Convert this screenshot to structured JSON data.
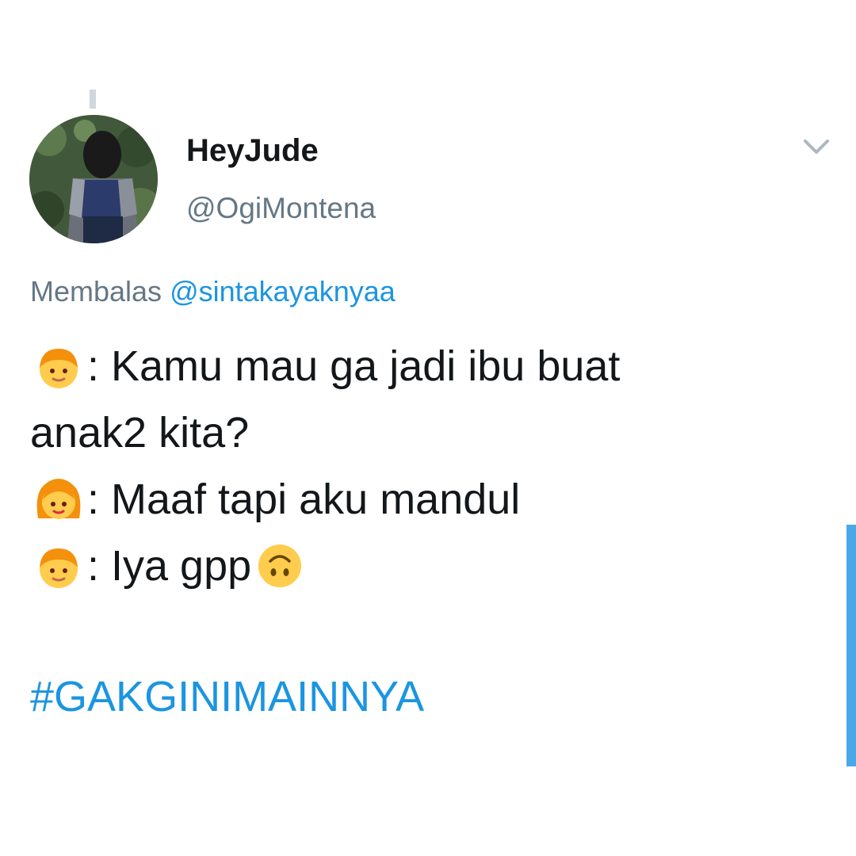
{
  "tweet": {
    "display_name": "HeyJude",
    "handle": "@OgiMontena",
    "reply_prefix": "Membalas",
    "reply_mention": "@sintakayaknyaa",
    "lines": [
      {
        "emoji": "boy-emoji",
        "text": ": Kamu mau ga jadi ibu buat"
      },
      {
        "emoji": "",
        "text": "anak2 kita?"
      },
      {
        "emoji": "girl-emoji",
        "text": ": Maaf tapi aku mandul"
      },
      {
        "emoji": "boy-emoji",
        "text": ": Iya gpp"
      }
    ],
    "trailing_emoji": "upside-down-face-emoji",
    "hashtag": "#GAKGINIMAINNYA"
  },
  "colors": {
    "text": "#14171a",
    "secondary": "#657786",
    "link": "#1b95e0",
    "scroll_accent": "#4aa8e8"
  },
  "icons": {
    "menu": "chevron-down-icon"
  }
}
